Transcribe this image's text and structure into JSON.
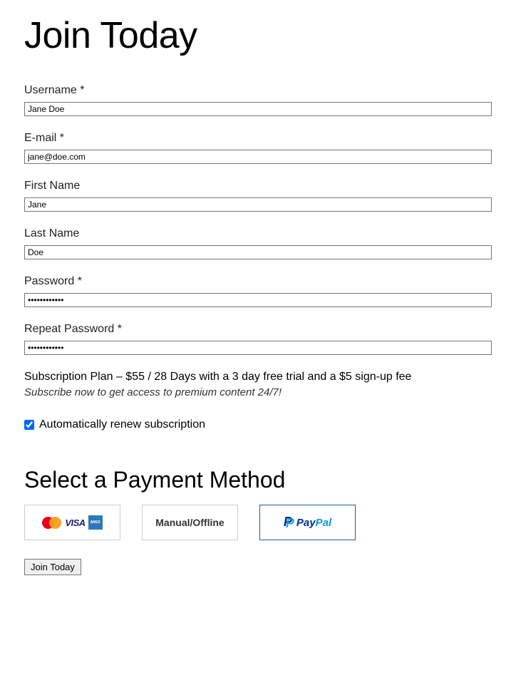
{
  "page_title": "Join Today",
  "fields": {
    "username": {
      "label": "Username *",
      "value": "Jane Doe"
    },
    "email": {
      "label": "E-mail *",
      "value": "jane@doe.com"
    },
    "first_name": {
      "label": "First Name",
      "value": "Jane"
    },
    "last_name": {
      "label": "Last Name",
      "value": "Doe"
    },
    "password": {
      "label": "Password *",
      "value": "••••••••••••"
    },
    "repeat_password": {
      "label": "Repeat Password *",
      "value": "••••••••••••"
    }
  },
  "plan": {
    "text": "Subscription Plan – $55 / 28 Days with a 3 day free trial and a $5 sign-up fee",
    "description": "Subscribe now to get access to premium content 24/7!"
  },
  "renew": {
    "label": "Automatically renew subscription",
    "checked": true
  },
  "payment": {
    "heading": "Select a Payment Method",
    "options": {
      "cards": {
        "visa_text": "VISA",
        "amex_text": "AMEX"
      },
      "manual": {
        "label": "Manual/Offline"
      },
      "paypal": {
        "text_pay": "Pay",
        "text_pal": "Pal",
        "selected": true
      }
    }
  },
  "submit_label": "Join Today"
}
